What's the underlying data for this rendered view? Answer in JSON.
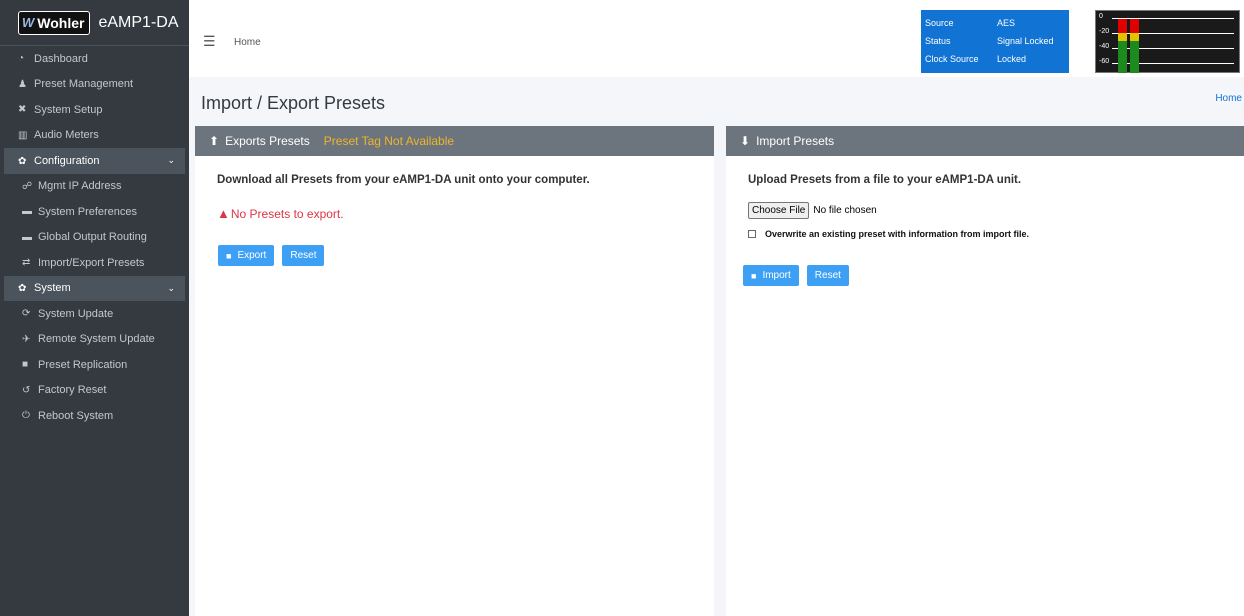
{
  "brand": {
    "logo_text": "Wohler",
    "product": "eAMP1-DA"
  },
  "sidebar": {
    "items": [
      {
        "label": "Dashboard",
        "icon": "dashboard-icon"
      },
      {
        "label": "Preset Management",
        "icon": "user-cog-icon"
      },
      {
        "label": "System Setup",
        "icon": "tools-icon"
      },
      {
        "label": "Audio Meters",
        "icon": "bar-chart-icon"
      }
    ],
    "configuration": {
      "label": "Configuration",
      "items": [
        {
          "label": "Mgmt IP Address",
          "icon": "network-icon"
        },
        {
          "label": "System Preferences",
          "icon": "keyboard-icon"
        },
        {
          "label": "Global Output Routing",
          "icon": "keyboard-icon"
        },
        {
          "label": "Import/Export Presets",
          "icon": "exchange-icon"
        }
      ]
    },
    "system": {
      "label": "System",
      "items": [
        {
          "label": "System Update",
          "icon": "sync-icon"
        },
        {
          "label": "Remote System Update",
          "icon": "satellite-icon"
        },
        {
          "label": "Preset Replication",
          "icon": "copy-icon"
        },
        {
          "label": "Factory Reset",
          "icon": "undo-icon"
        },
        {
          "label": "Reboot System",
          "icon": "power-icon"
        }
      ]
    }
  },
  "topbar": {
    "home": "Home",
    "status": [
      {
        "key": "Source",
        "value": "AES"
      },
      {
        "key": "Status",
        "value": "Signal Locked"
      },
      {
        "key": "Clock Source",
        "value": "Locked"
      }
    ],
    "meter_ticks": [
      "0",
      "-20",
      "-40",
      "-60"
    ]
  },
  "page": {
    "title": "Import / Export Presets",
    "breadcrumb": "Home"
  },
  "export": {
    "header": "Exports Presets",
    "tag": "Preset Tag Not Available",
    "description": "Download all Presets from your eAMP1-DA unit onto your computer.",
    "warning": "No Presets to export.",
    "export_label": "Export",
    "reset_label": "Reset"
  },
  "import": {
    "header": "Import Presets",
    "description": "Upload Presets from a file to your eAMP1-DA unit.",
    "choose_file_label": "Choose File",
    "file_status": "No file chosen",
    "overwrite_label": "Overwrite an existing preset with information from import file.",
    "import_label": "Import",
    "reset_label": "Reset"
  },
  "colors": {
    "sidebar_bg": "#343a40",
    "card_header": "#6c757d",
    "button_blue": "#3ea0f5",
    "status_blue": "#1173d4",
    "warning_red": "#dc3545",
    "tag_amber": "#f0b429"
  }
}
